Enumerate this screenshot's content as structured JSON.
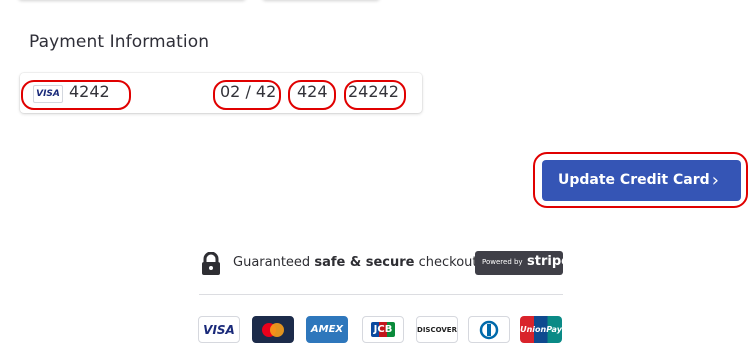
{
  "section": {
    "title": "Payment Information"
  },
  "card": {
    "brand_icon": "visa-icon",
    "brand_label": "VISA",
    "number": "4242",
    "expiry": "02 / 42",
    "cvc": "424",
    "zip": "24242"
  },
  "actions": {
    "update_label": "Update Credit Card",
    "chevron_icon": "chevron-right-icon"
  },
  "secure": {
    "prefix": "Guaranteed",
    "bold": "safe & secure",
    "suffix": "checkout",
    "badge_small": "Powered by",
    "badge_big": "stripe"
  },
  "brand_colors": {
    "button": "#3555b5",
    "highlight": "#e00000"
  },
  "payment_logos": [
    {
      "name": "visa",
      "label": "VISA"
    },
    {
      "name": "mastercard",
      "label": ""
    },
    {
      "name": "amex",
      "label": "AMEX"
    },
    {
      "name": "jcb",
      "label": "JCB"
    },
    {
      "name": "discover",
      "label": "DISCOVER"
    },
    {
      "name": "diners",
      "label": ""
    },
    {
      "name": "unionpay",
      "label": "UnionPay"
    }
  ]
}
